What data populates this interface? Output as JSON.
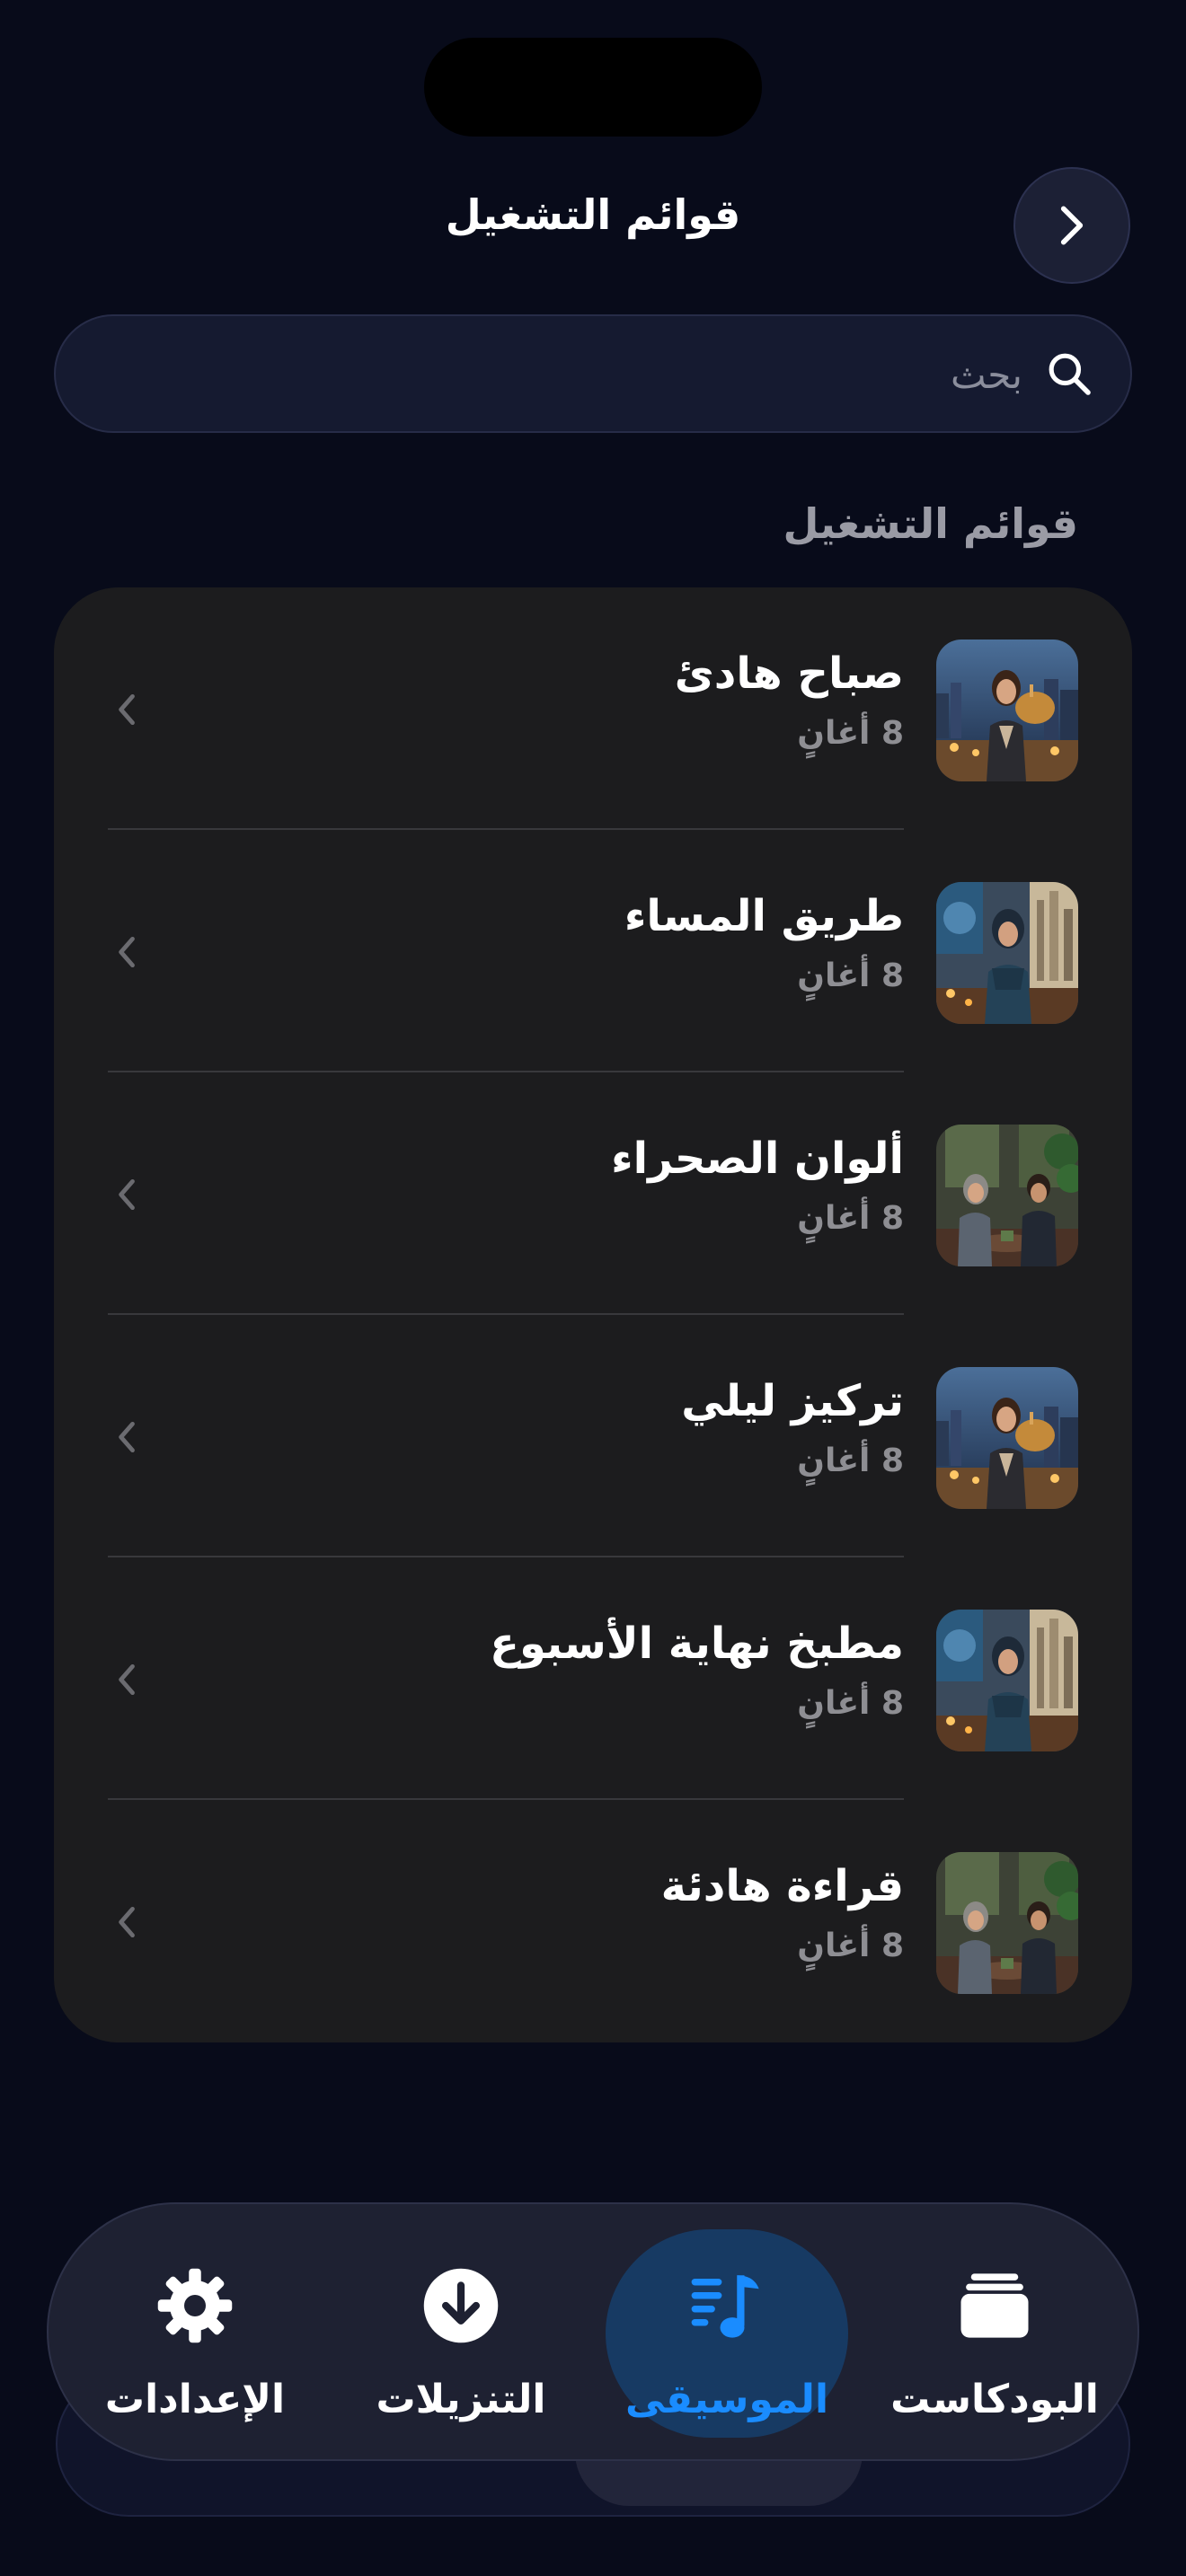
{
  "header": {
    "title": "قوائم التشغيل",
    "back_icon": "chevron-right-icon"
  },
  "search": {
    "placeholder": "بحث",
    "icon": "search-icon"
  },
  "section": {
    "title": "قوائم التشغيل"
  },
  "playlists": [
    {
      "name": "صباح هادئ",
      "count": "8 أغانٍ",
      "art": "woman-city-night"
    },
    {
      "name": "طريق المساء",
      "count": "8 أغانٍ",
      "art": "woman-hijab-window"
    },
    {
      "name": "ألوان الصحراء",
      "count": "8 أغانٍ",
      "art": "couple-cafe"
    },
    {
      "name": "تركيز ليلي",
      "count": "8 أغانٍ",
      "art": "woman-city-night"
    },
    {
      "name": "مطبخ نهاية الأسبوع",
      "count": "8 أغانٍ",
      "art": "woman-hijab-window"
    },
    {
      "name": "قراءة هادئة",
      "count": "8 أغانٍ",
      "art": "couple-cafe"
    }
  ],
  "tabs": [
    {
      "label": "البودكاست",
      "icon": "podcast-stack-icon",
      "active": false
    },
    {
      "label": "الموسيقى",
      "icon": "music-list-icon",
      "active": true
    },
    {
      "label": "التنزيلات",
      "icon": "download-icon",
      "active": false
    },
    {
      "label": "الإعدادات",
      "icon": "gear-icon",
      "active": false
    }
  ],
  "colors": {
    "background": "#080b1a",
    "accent": "#1a8cff",
    "card": "#1c1c1e",
    "secondary_text": "#8e8e93"
  }
}
